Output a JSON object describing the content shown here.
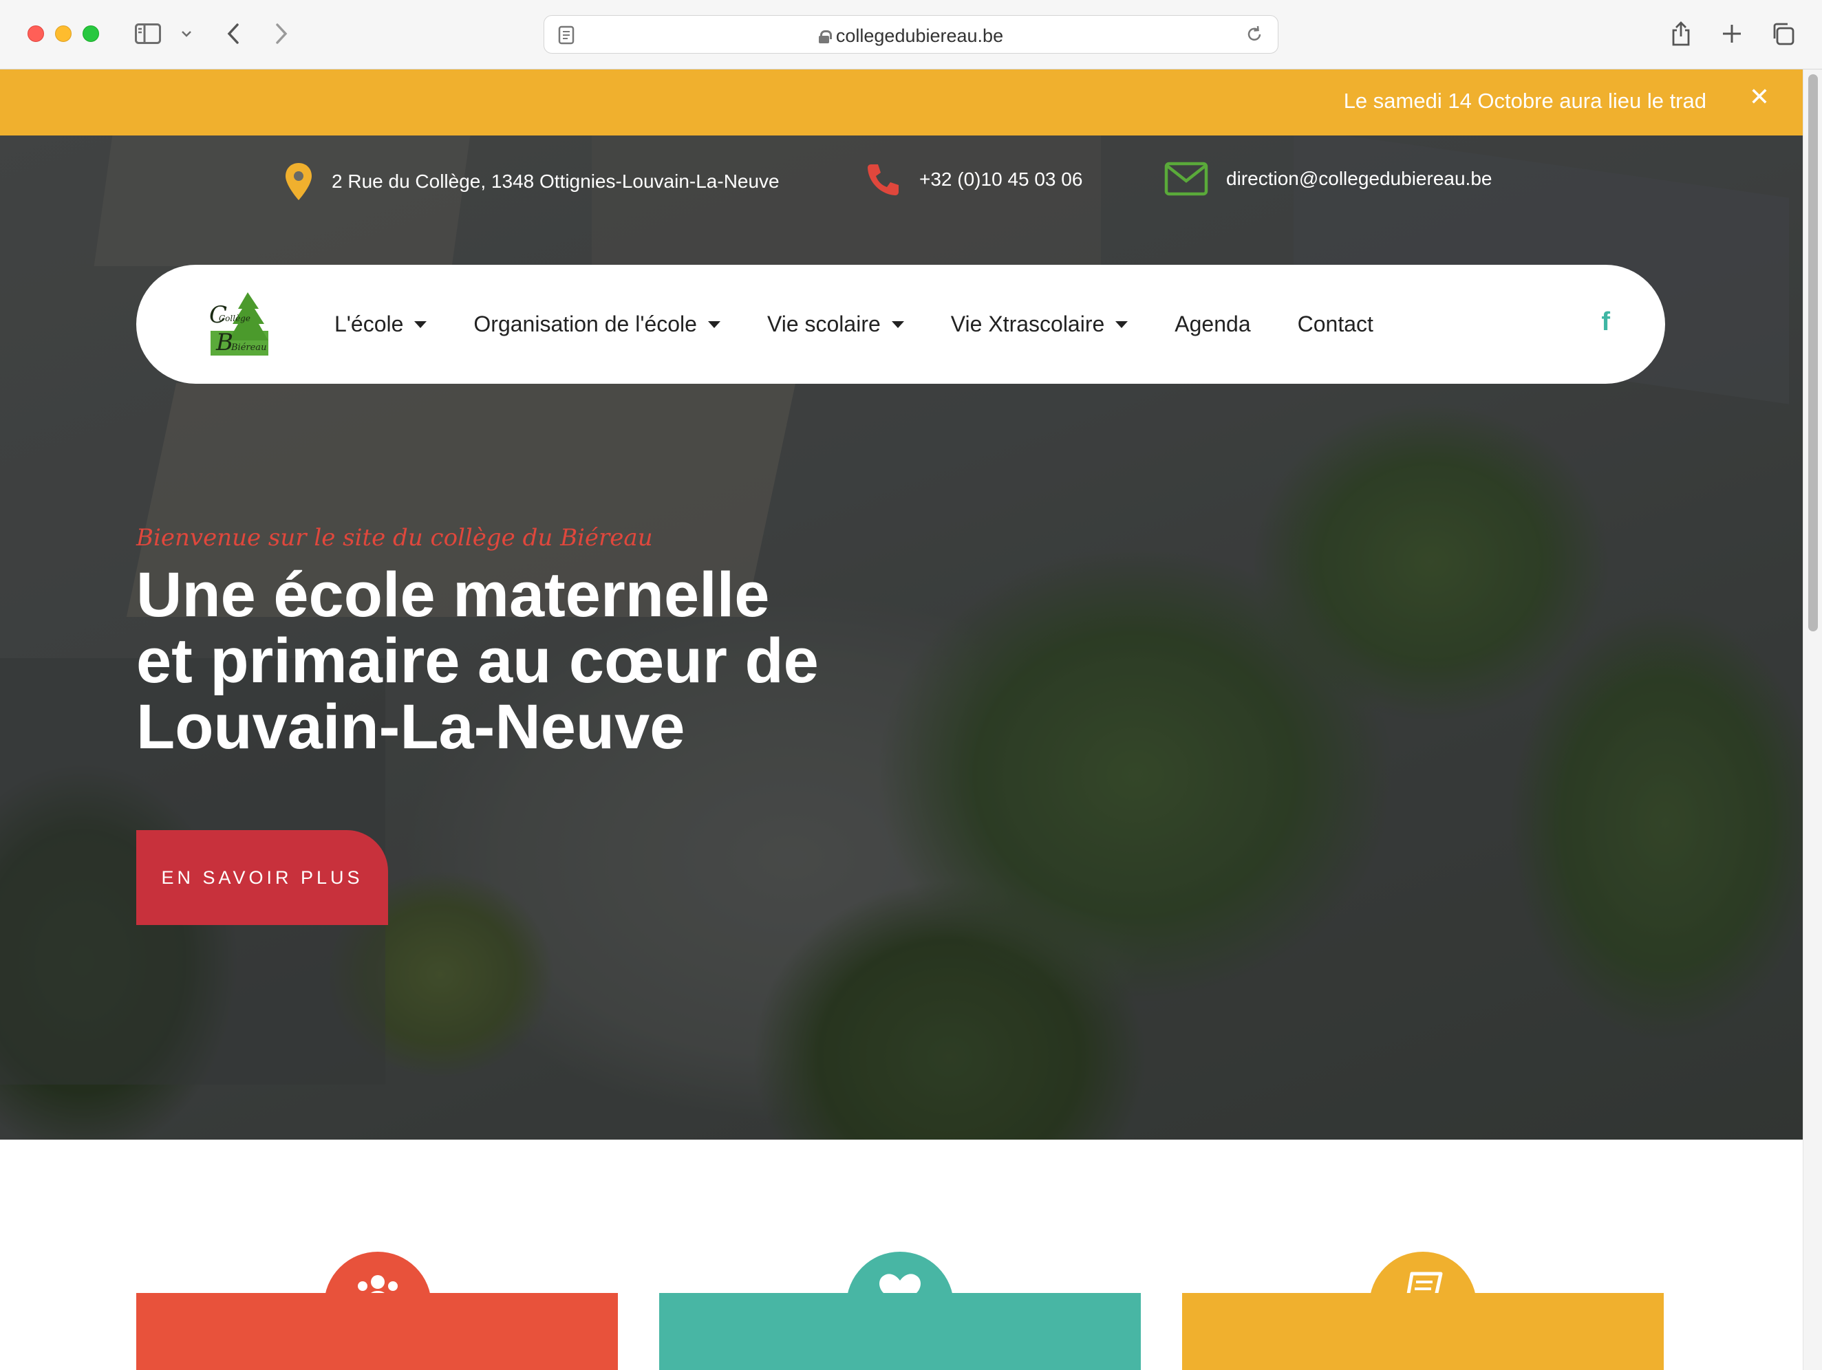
{
  "browser": {
    "url": "collegedubiereau.be"
  },
  "announcement": {
    "text": "Le samedi 14 Octobre aura lieu le trad",
    "close_label": "✕"
  },
  "contact": {
    "address": "2 Rue du Collège, 1348 Ottignies-Louvain-La-Neuve",
    "phone": "+32 (0)10 45 03 06",
    "email": "direction@collegedubiereau.be"
  },
  "logo": {
    "line1": "Collège",
    "line2": "Biéreau"
  },
  "nav": {
    "items": [
      {
        "label": "L'école",
        "dropdown": true
      },
      {
        "label": "Organisation de l'école",
        "dropdown": true
      },
      {
        "label": "Vie scolaire",
        "dropdown": true
      },
      {
        "label": "Vie Xtrascolaire",
        "dropdown": true
      },
      {
        "label": "Agenda",
        "dropdown": false
      },
      {
        "label": "Contact",
        "dropdown": false
      }
    ],
    "social": "f"
  },
  "hero": {
    "tagline": "Bienvenue sur le site du collège du Biéreau",
    "headline_line1": "Une école maternelle",
    "headline_line2": "et primaire au cœur de",
    "headline_line3": "Louvain-La-Neuve",
    "cta_label": "EN SAVOIR PLUS"
  },
  "cards": [
    {
      "icon": "users-icon",
      "color": "#e8523b"
    },
    {
      "icon": "heart-icon",
      "color": "#48b6a4"
    },
    {
      "icon": "book-icon",
      "color": "#f0b02e"
    }
  ],
  "colors": {
    "announce": "#f0b02e",
    "accent_red": "#c8313c",
    "tagline": "#e0473c",
    "teal": "#3fb6a4",
    "green": "#5aaa3a"
  }
}
